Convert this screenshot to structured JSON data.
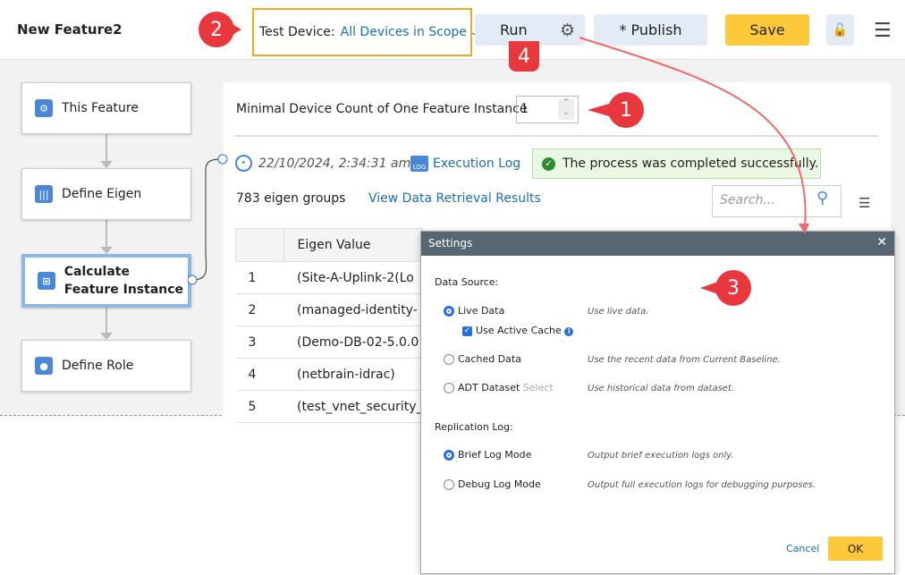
{
  "header": {
    "title": "New Feature2",
    "test_device_label": "Test Device:",
    "test_device_value": "All Devices in Scope",
    "run": "Run",
    "publish": "* Publish",
    "save": "Save"
  },
  "flow": {
    "nodes": [
      {
        "label": "This Feature"
      },
      {
        "label": "Define Eigen"
      },
      {
        "label": "Calculate Feature Instance"
      },
      {
        "label": "Define Role"
      }
    ]
  },
  "main": {
    "min_device_label": "Minimal Device Count of One Feature Instance",
    "min_device_value": "1",
    "timestamp": "22/10/2024, 2:34:31 am",
    "execution_log": "Execution Log",
    "log_icon_text": "LOG",
    "success": "The process was completed successfully.",
    "groups": "783 eigen groups",
    "view_results": "View Data Retrieval Results",
    "search_placeholder": "Search...",
    "table": {
      "header": "Eigen Value",
      "rows": [
        {
          "n": "1",
          "v": "(Site-A-Uplink-2(Lo"
        },
        {
          "n": "2",
          "v": "(managed-identity-"
        },
        {
          "n": "3",
          "v": "(Demo-DB-02-5.0.0"
        },
        {
          "n": "4",
          "v": "(netbrain-idrac)"
        },
        {
          "n": "5",
          "v": "(test_vnet_security_"
        }
      ]
    }
  },
  "dialog": {
    "title": "Settings",
    "data_source": "Data Source:",
    "live": "Live Data",
    "live_desc": "Use live data.",
    "active_cache": "Use Active Cache",
    "cached": "Cached Data",
    "cached_desc": "Use the recent data from Current Baseline.",
    "adt": "ADT Dataset",
    "adt_select": "Select",
    "adt_desc": "Use historical data from dataset.",
    "replication": "Replication Log:",
    "brief": "Brief Log Mode",
    "brief_desc": "Output brief execution logs only.",
    "debug": "Debug Log Mode",
    "debug_desc": "Output full execution logs for debugging purposes.",
    "cancel": "Cancel",
    "ok": "OK",
    "selected_source": "Live Data",
    "selected_log": "Brief Log Mode",
    "use_active_cache": true
  },
  "annotations": [
    "1",
    "2",
    "3",
    "4"
  ],
  "colors": {
    "accent": "#1a6fb5",
    "save": "#fdc93a",
    "annotation": "#e8383d",
    "highlight": "#f5a623"
  }
}
